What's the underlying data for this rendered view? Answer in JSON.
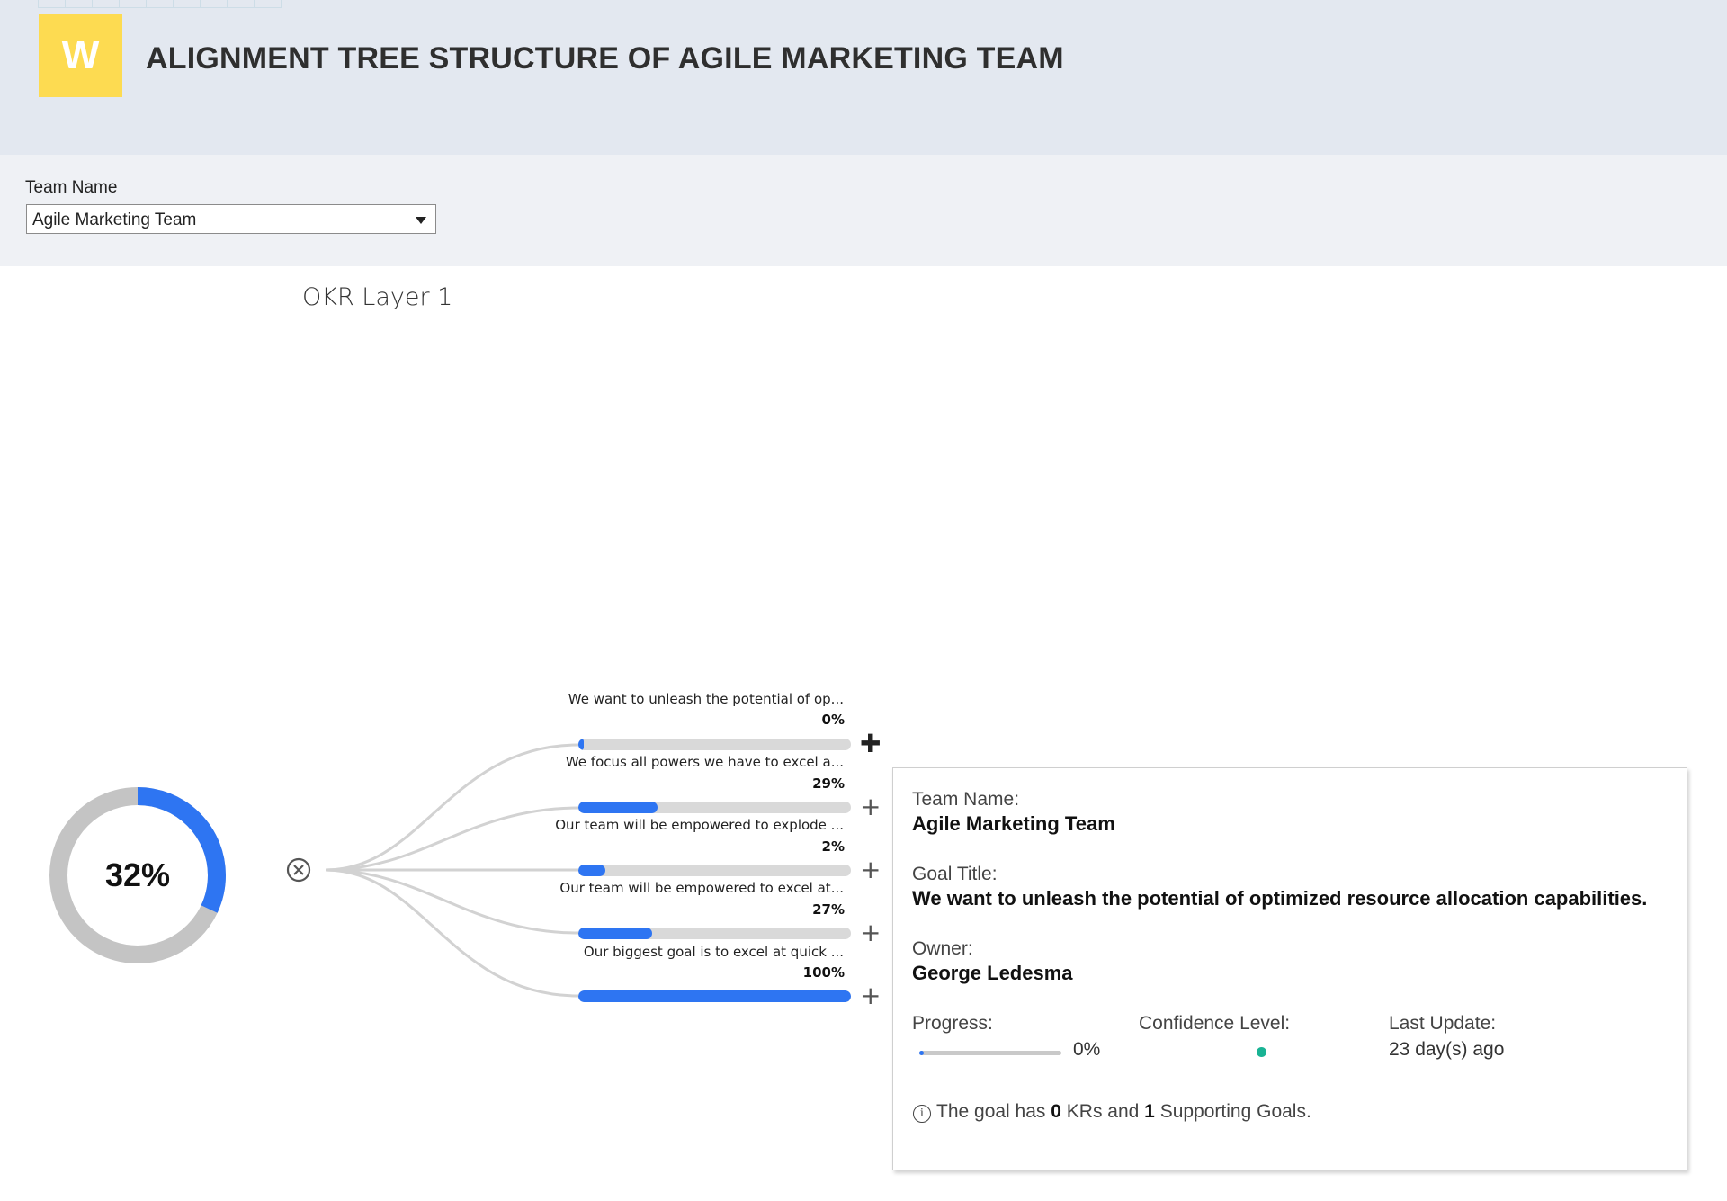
{
  "header": {
    "logo_letter": "W",
    "title": "ALIGNMENT TREE STRUCTURE OF AGILE MARKETING TEAM",
    "logo_color": "#fddb51"
  },
  "filter": {
    "label": "Team Name",
    "selected": "Agile Marketing Team"
  },
  "layer": {
    "label": "OKR Layer 1"
  },
  "overall": {
    "progress_label": "32%",
    "progress": 0.32
  },
  "goals": [
    {
      "title": "We want to unleash the potential of op...",
      "pct_label": "0%",
      "progress": 0.0
    },
    {
      "title": "We focus all powers we have to excel a...",
      "pct_label": "29%",
      "progress": 0.29
    },
    {
      "title": "Our team will be empowered to explode ...",
      "pct_label": "2%",
      "progress": 0.02
    },
    {
      "title": "Our team will be empowered to excel at...",
      "pct_label": "27%",
      "progress": 0.27
    },
    {
      "title": "Our biggest goal is to excel at quick ...",
      "pct_label": "100%",
      "progress": 1.0
    }
  ],
  "tooltip": {
    "team_label": "Team Name:",
    "team_value": "Agile Marketing Team",
    "goal_label": "Goal Title:",
    "goal_value": "We want to unleash the potential of optimized resource allocation capabilities.",
    "owner_label": "Owner:",
    "owner_value": "George Ledesma",
    "progress_label": "Progress:",
    "progress_value": "0%",
    "progress": 0.0,
    "confidence_label": "Confidence Level:",
    "confidence_color": "#19b394",
    "update_label": "Last Update:",
    "update_value": "23 day(s) ago",
    "note_prefix": "The goal has ",
    "note_krs": "0",
    "note_mid": " KRs and ",
    "note_supporting": "1",
    "note_suffix": " Supporting Goals."
  },
  "colors": {
    "accent": "#2e75f2",
    "track": "#d9d9d9",
    "donut_track": "#c4c4c4"
  }
}
